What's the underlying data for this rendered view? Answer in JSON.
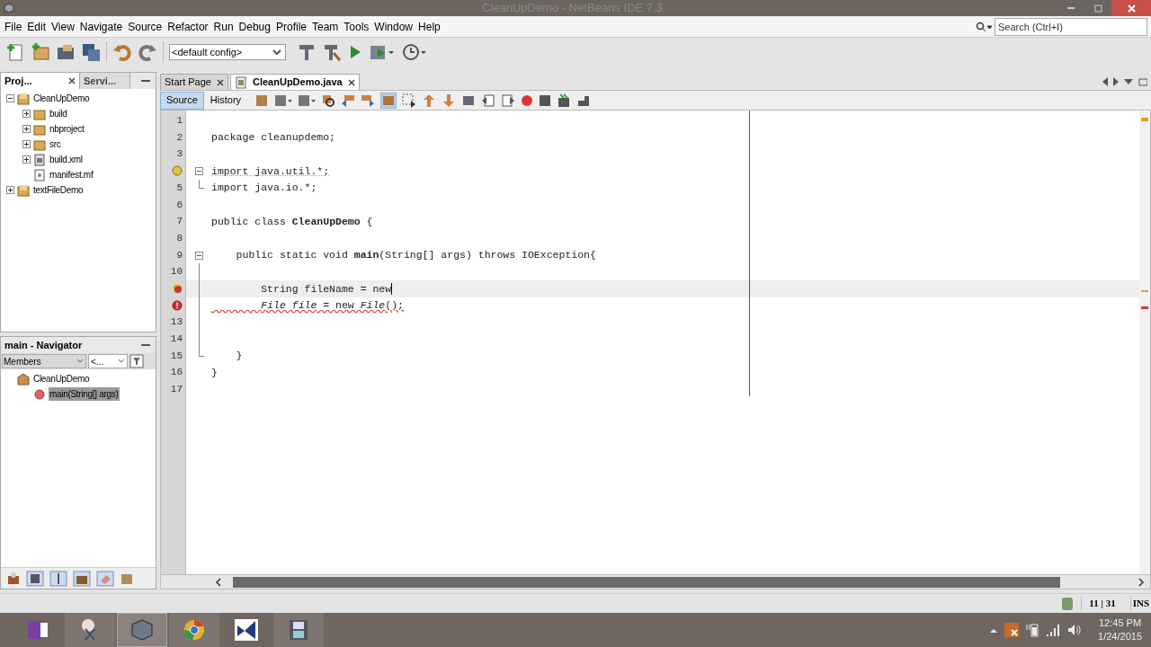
{
  "window": {
    "title": "CleanUpDemo - NetBeans IDE 7.3"
  },
  "menu": [
    "File",
    "Edit",
    "View",
    "Navigate",
    "Source",
    "Refactor",
    "Run",
    "Debug",
    "Profile",
    "Team",
    "Tools",
    "Window",
    "Help"
  ],
  "search": {
    "placeholder": "Search (Ctrl+I)"
  },
  "config": {
    "value": "<default config>"
  },
  "left_tabs": [
    {
      "label": "Proj...",
      "selected": true
    },
    {
      "label": "Servi...",
      "selected": false
    }
  ],
  "project_tree": [
    {
      "label": "CleanUpDemo",
      "kind": "project",
      "expanded": true,
      "children": [
        {
          "label": "build",
          "kind": "folder",
          "expanded": false
        },
        {
          "label": "nbproject",
          "kind": "folder",
          "expanded": false
        },
        {
          "label": "src",
          "kind": "folder",
          "expanded": false
        },
        {
          "label": "build.xml",
          "kind": "xml",
          "expanded": false
        },
        {
          "label": "manifest.mf",
          "kind": "file"
        }
      ]
    },
    {
      "label": "textFileDemo",
      "kind": "project",
      "expanded": false
    }
  ],
  "navigator": {
    "title": "main - Navigator",
    "filter": "Members",
    "sort": "<...",
    "tree": [
      {
        "label": "CleanUpDemo",
        "kind": "class",
        "children": [
          {
            "label": "main(String[] args)",
            "kind": "method",
            "selected": true
          }
        ]
      }
    ]
  },
  "editor_tabs": [
    {
      "label": "Start Page",
      "selected": false
    },
    {
      "label": "CleanUpDemo.java",
      "selected": true
    }
  ],
  "view_tabs": [
    {
      "label": "Source",
      "selected": true
    },
    {
      "label": "History",
      "selected": false
    }
  ],
  "code": [
    {
      "kind": "number",
      "number": "1"
    },
    {
      "kind": "number",
      "number": "2",
      "text": "package cleanupdemo;"
    },
    {
      "kind": "number",
      "number": "3"
    },
    {
      "kind": "hint",
      "text": "import java.util.*;",
      "fold_start": true
    },
    {
      "kind": "number",
      "number": "5",
      "text": "import java.io.*;",
      "fold_end": true
    },
    {
      "kind": "number",
      "number": "6"
    },
    {
      "kind": "number",
      "number": "7",
      "text": "public class **CleanUpDemo** {"
    },
    {
      "kind": "number",
      "number": "8"
    },
    {
      "kind": "number",
      "number": "9",
      "text": "    public static void **main**(String[] args) throws IOException{",
      "fold_start": true
    },
    {
      "kind": "number",
      "number": "10"
    },
    {
      "kind": "error-hint",
      "text": "        String fileName = new",
      "current": true
    },
    {
      "kind": "error",
      "text": "        *File file* = new *File*();"
    },
    {
      "kind": "number",
      "number": "13"
    },
    {
      "kind": "number",
      "number": "14"
    },
    {
      "kind": "number",
      "number": "15",
      "text": "    }",
      "fold_end": true
    },
    {
      "kind": "number",
      "number": "16",
      "text": "}"
    },
    {
      "kind": "number",
      "number": "17"
    }
  ],
  "status_bar": {
    "position": "11 | 31",
    "mode": "INS"
  },
  "taskbar": {
    "time": "12:45 PM",
    "date": "1/24/2015"
  }
}
